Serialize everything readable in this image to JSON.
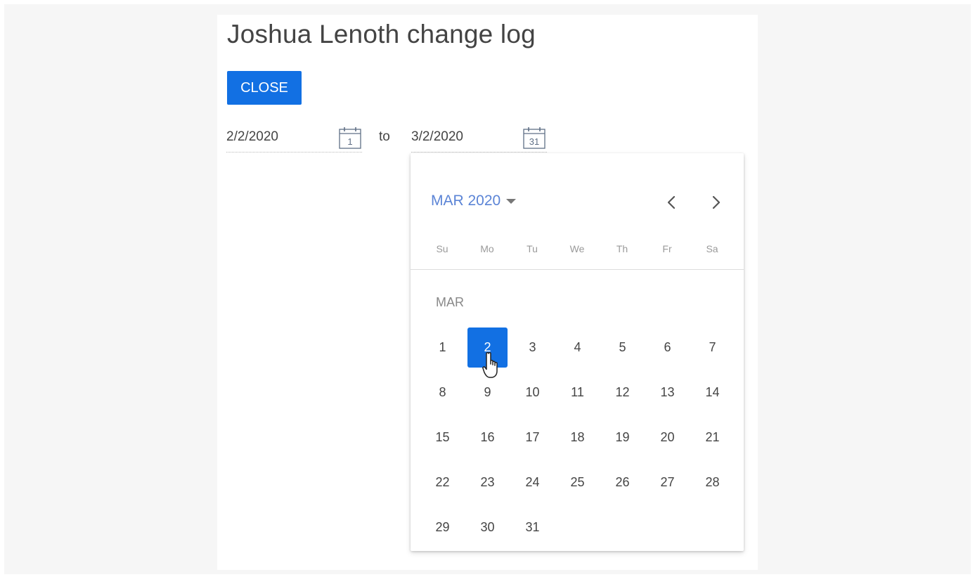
{
  "page": {
    "title": "Joshua Lenoth change log",
    "close_label": "CLOSE"
  },
  "date_range": {
    "from_value": "2/2/2020",
    "from_icon_day": "1",
    "separator": "to",
    "to_value": "3/2/2020",
    "to_icon_day": "31"
  },
  "datepicker": {
    "month_year_label": "MAR 2020",
    "weekdays": [
      "Su",
      "Mo",
      "Tu",
      "We",
      "Th",
      "Fr",
      "Sa"
    ],
    "month_label": "MAR",
    "days": [
      "1",
      "2",
      "3",
      "4",
      "5",
      "6",
      "7",
      "8",
      "9",
      "10",
      "11",
      "12",
      "13",
      "14",
      "15",
      "16",
      "17",
      "18",
      "19",
      "20",
      "21",
      "22",
      "23",
      "24",
      "25",
      "26",
      "27",
      "28",
      "29",
      "30",
      "31"
    ],
    "first_weekday_index": 0,
    "selected_day": "2"
  },
  "colors": {
    "accent": "#1270e3",
    "month_link": "#5b84d6",
    "icon_stroke": "#5f6f86"
  },
  "icons": {
    "from_calendar": "calendar-icon",
    "to_calendar": "calendar-icon",
    "month_dropdown": "caret-down-icon",
    "prev": "chevron-left-icon",
    "next": "chevron-right-icon",
    "cursor": "hand-pointer-icon"
  }
}
